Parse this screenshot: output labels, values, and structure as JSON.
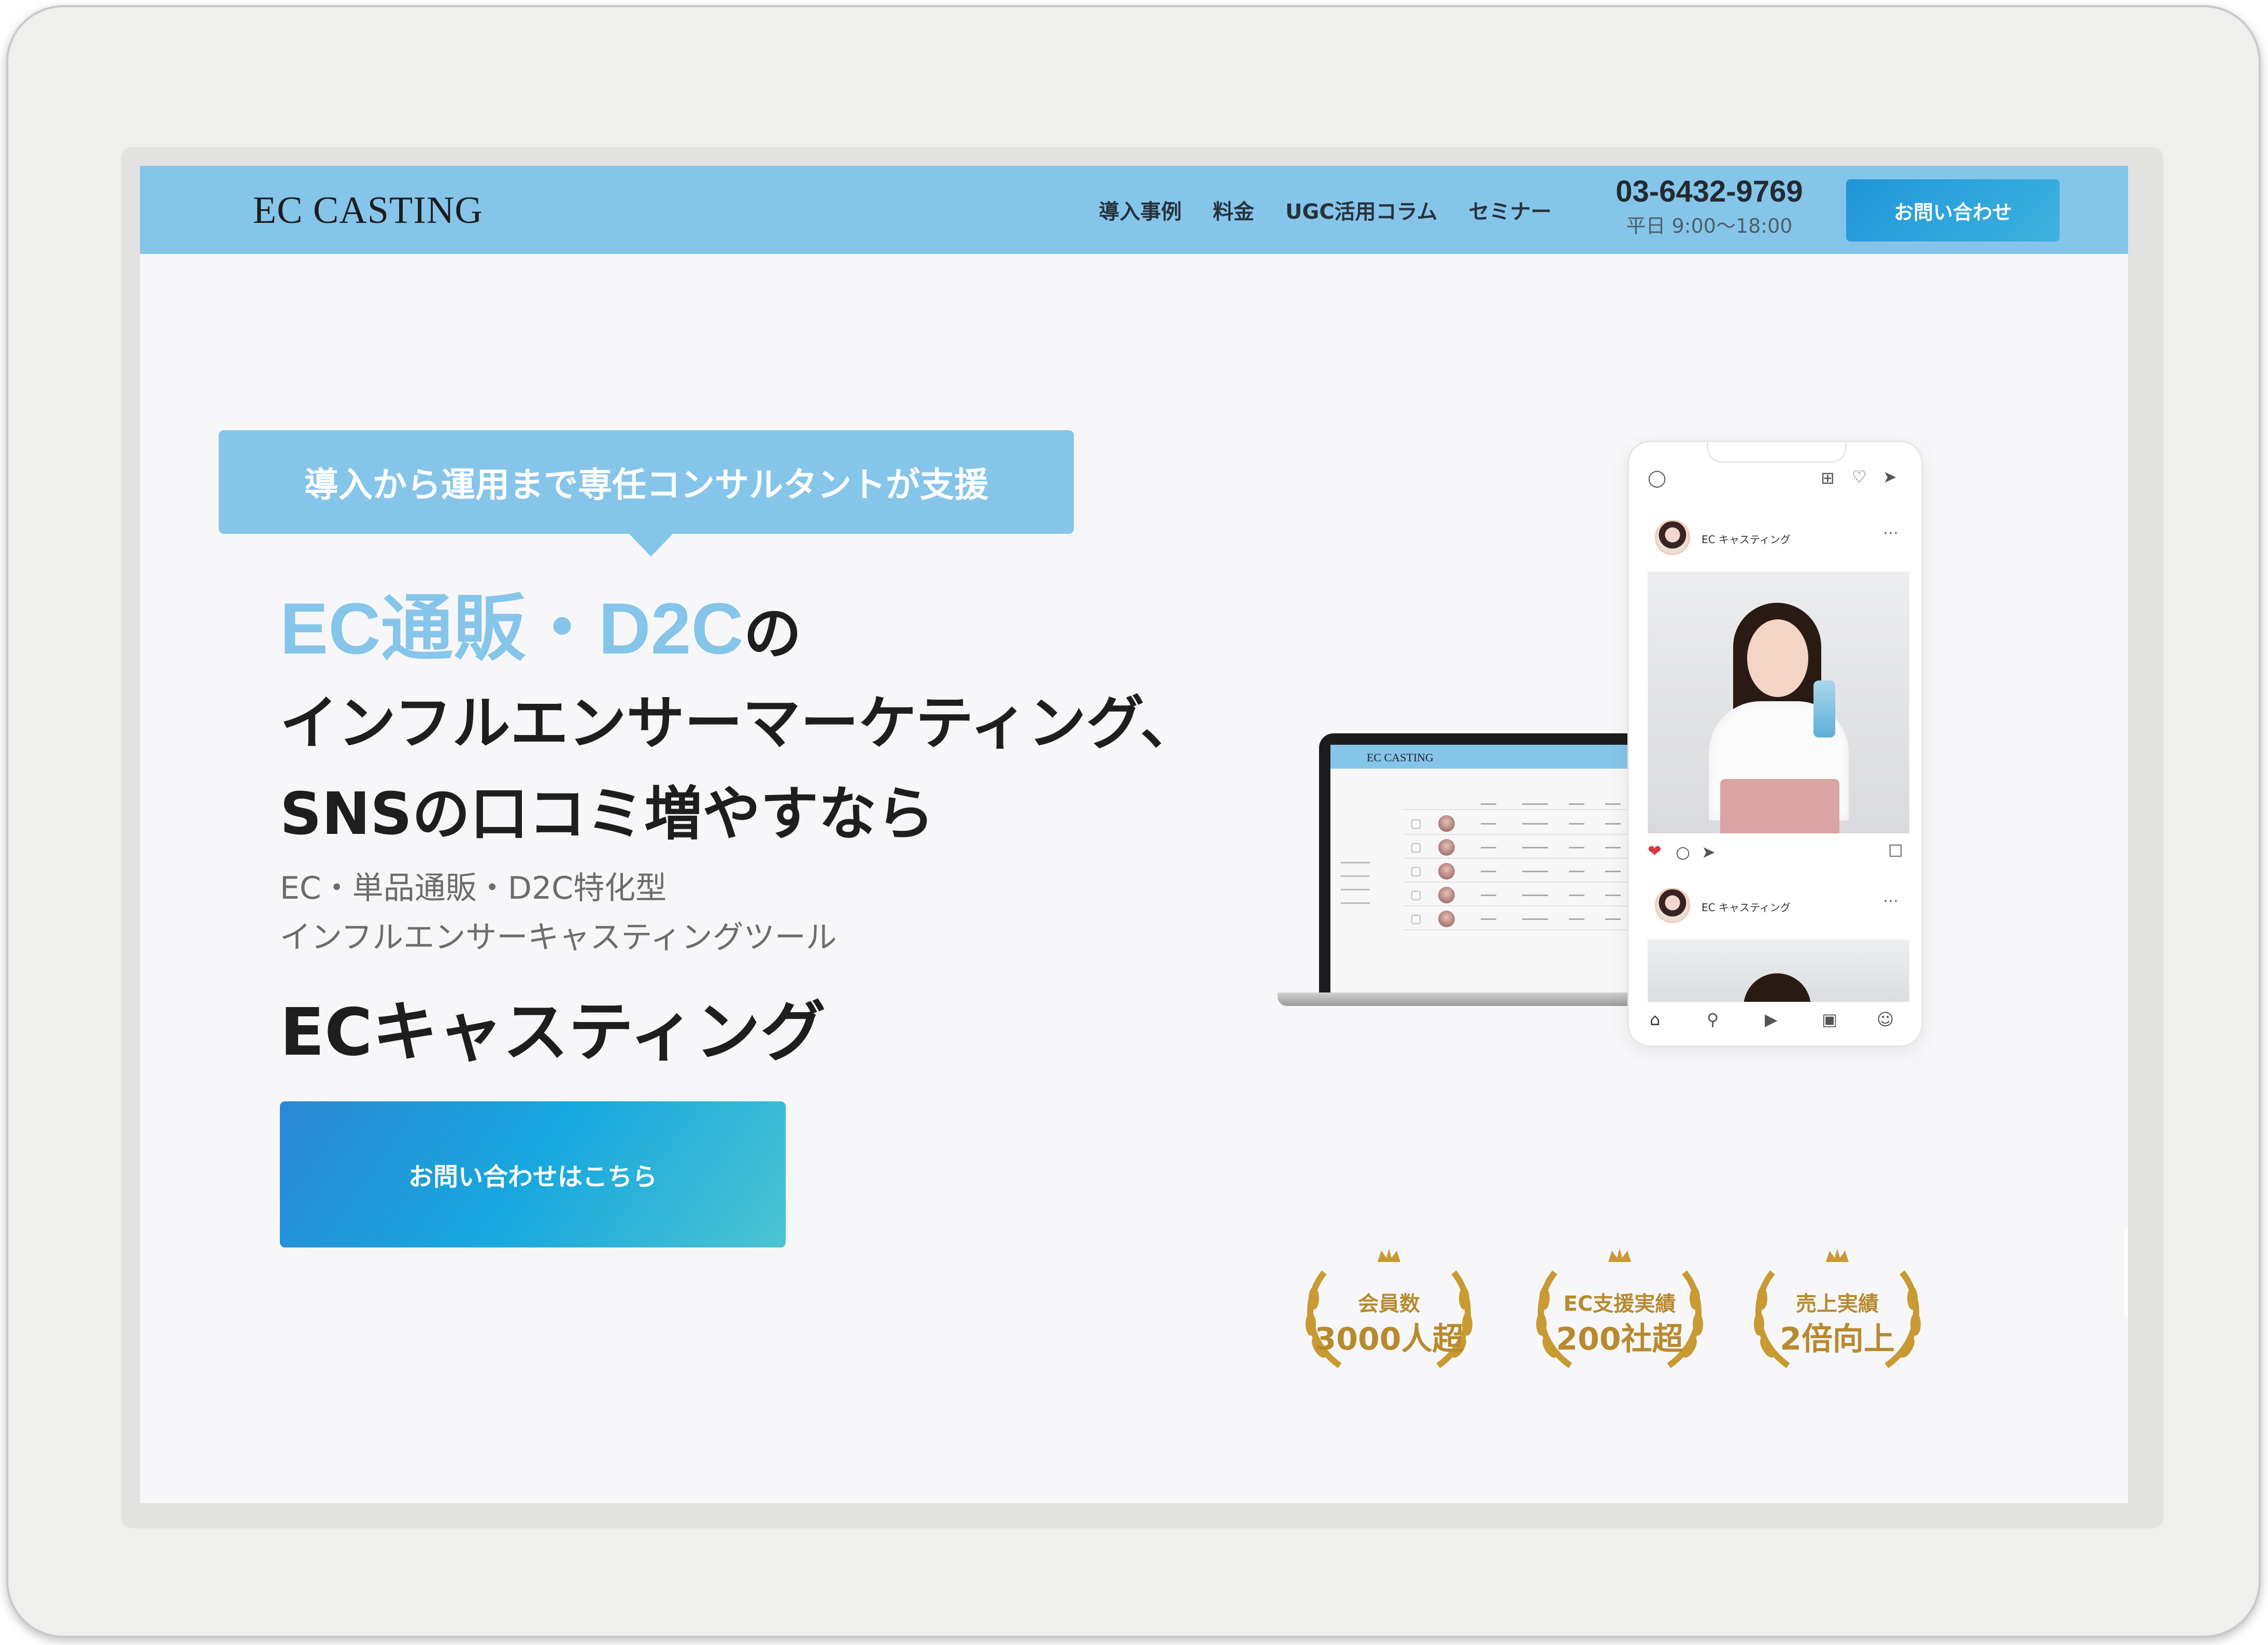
{
  "header": {
    "logo": "EC CASTING",
    "nav": [
      "導入事例",
      "料金",
      "UGC活用コラム",
      "セミナー"
    ],
    "phone_number": "03-6432-9769",
    "phone_hours": "平日 9:00〜18:00",
    "cta_label": "お問い合わせ"
  },
  "hero": {
    "tag": "導入から運用まで専任コンサルタントが支援",
    "headline_accent": "EC通販・D2C",
    "headline_rest": "の",
    "headline_line2": "インフルエンサーマーケティング、",
    "headline_line3": "SNSの口コミ増やすなら",
    "sub_line1": "EC・単品通販・D2C特化型",
    "sub_line2": "インフルエンサーキャスティングツール",
    "product_name": "ECキャスティング",
    "cta_label": "お問い合わせはこちら"
  },
  "mockup": {
    "laptop_logo": "EC CASTING",
    "phone_user_1": "EC キャスティング",
    "phone_user_2": "EC キャスティング"
  },
  "awards": [
    {
      "top": "会員数",
      "bottom": "3000人超"
    },
    {
      "top": "EC支援実績",
      "bottom": "200社超"
    },
    {
      "top": "売上実績",
      "bottom": "2倍向上"
    }
  ],
  "colors": {
    "header_bg": "#86c5ea",
    "accent": "#86c5ea",
    "gold": "#b88a2e",
    "cta_gradient_start": "#2b88d4",
    "cta_gradient_end": "#4cc4d2"
  }
}
